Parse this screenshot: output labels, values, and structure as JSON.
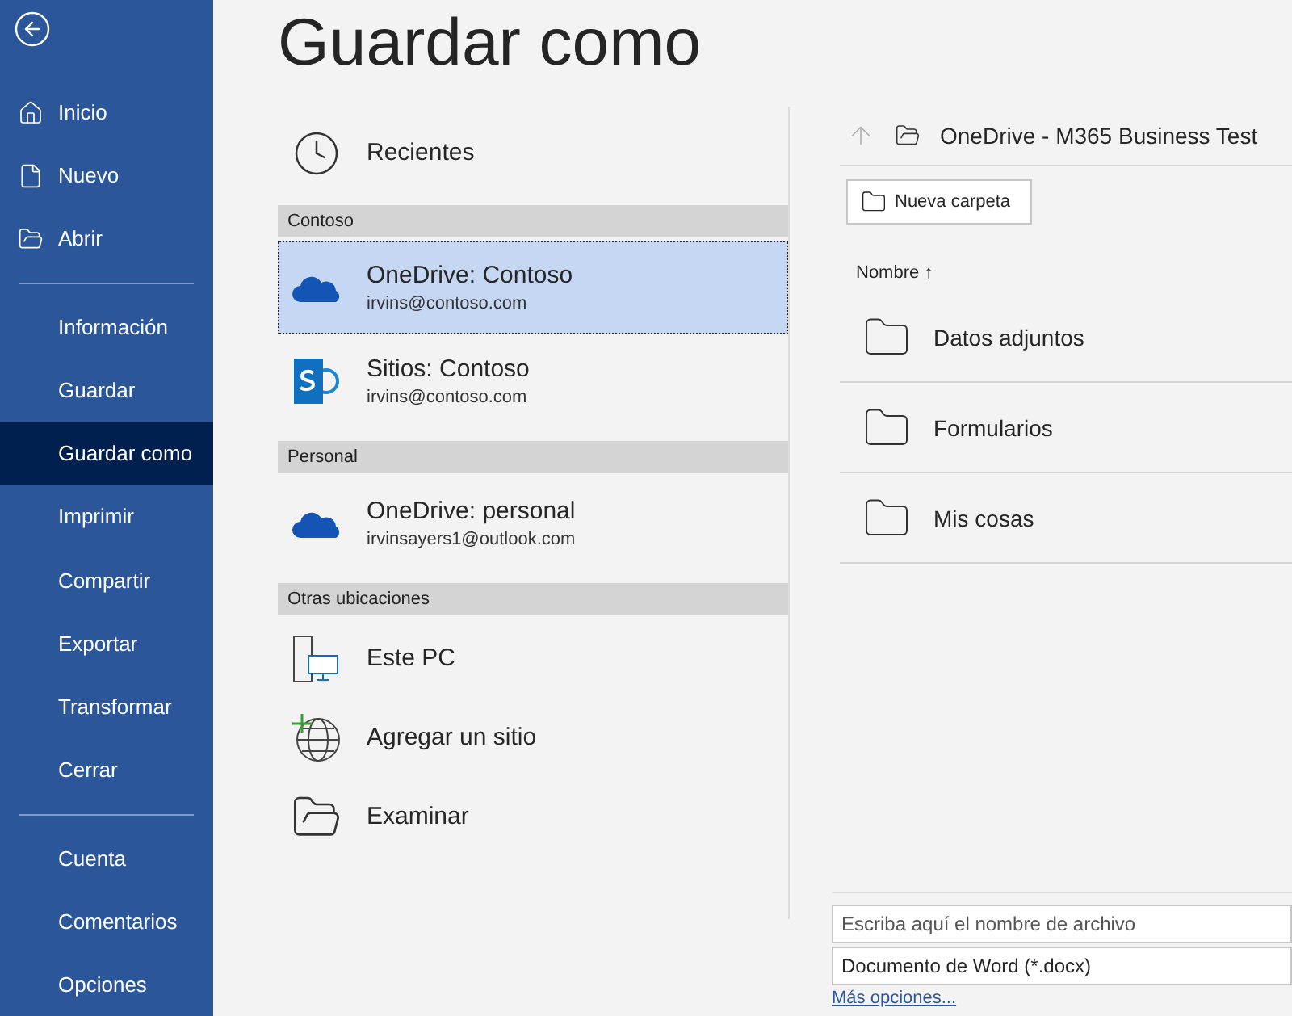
{
  "sidebar": {
    "back": {
      "kind": "back"
    },
    "groups": [
      [
        {
          "label": "Inicio",
          "kind": "home",
          "selected": false
        },
        {
          "label": "Nuevo",
          "kind": "document",
          "selected": false
        },
        {
          "label": "Abrir",
          "kind": "folder",
          "selected": false
        }
      ],
      [
        {
          "label": "Información",
          "kind": "text",
          "selected": false
        },
        {
          "label": "Guardar",
          "kind": "text",
          "selected": false
        },
        {
          "label": "Guardar como",
          "kind": "text",
          "selected": true
        },
        {
          "label": "Imprimir",
          "kind": "text",
          "selected": false
        },
        {
          "label": "Compartir",
          "kind": "text",
          "selected": false
        },
        {
          "label": "Exportar",
          "kind": "text",
          "selected": false
        },
        {
          "label": "Transformar",
          "kind": "text",
          "selected": false
        },
        {
          "label": "Cerrar",
          "kind": "text",
          "selected": false
        }
      ],
      [
        {
          "label": "Cuenta",
          "kind": "text",
          "selected": false
        },
        {
          "label": "Comentarios",
          "kind": "text",
          "selected": false
        },
        {
          "label": "Opciones",
          "kind": "text",
          "selected": false
        }
      ]
    ]
  },
  "page_title": "Guardar como",
  "locations": [
    {
      "items": [
        {
          "kind": "clock",
          "title": "Recientes",
          "selected": false
        }
      ]
    },
    {
      "header": "Contoso",
      "items": [
        {
          "kind": "cloud",
          "title": "OneDrive: Contoso",
          "subtitle": "irvins@contoso.com",
          "selected": true
        },
        {
          "kind": "sharepoint",
          "title": "Sitios: Contoso",
          "subtitle": "irvins@contoso.com",
          "selected": false
        }
      ]
    },
    {
      "header": "Personal",
      "items": [
        {
          "kind": "cloud",
          "title": "OneDrive: personal",
          "subtitle": "irvinsayers1@outlook.com",
          "selected": false
        }
      ]
    },
    {
      "header": "Otras ubicaciones",
      "items": [
        {
          "kind": "pc",
          "title": "Este PC",
          "selected": false
        },
        {
          "kind": "globe",
          "title": "Agregar un sitio",
          "selected": false
        },
        {
          "kind": "folder",
          "title": "Examinar",
          "selected": false
        }
      ]
    }
  ],
  "browser": {
    "path": "OneDrive - M365 Business Test",
    "new_folder_button": "Nueva carpeta",
    "column_header": "Nombre",
    "sort_arrow": "↑",
    "folders": [
      {
        "name": "Datos adjuntos"
      },
      {
        "name": "Formularios"
      },
      {
        "name": "Mis cosas"
      }
    ],
    "filename_field": {
      "placeholder": "Escriba aquí el nombre de archivo"
    },
    "file_type": "Documento de Word (*.docx)",
    "more_options_link": "Más opciones..."
  }
}
